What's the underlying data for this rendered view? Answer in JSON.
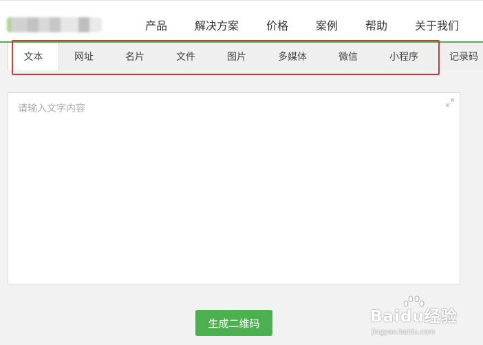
{
  "nav": {
    "items": [
      {
        "label": "产品"
      },
      {
        "label": "解决方案"
      },
      {
        "label": "价格"
      },
      {
        "label": "案例"
      },
      {
        "label": "帮助"
      },
      {
        "label": "关于我们"
      }
    ]
  },
  "tabs": {
    "items": [
      {
        "label": "文本",
        "active": true
      },
      {
        "label": "网址"
      },
      {
        "label": "名片"
      },
      {
        "label": "文件"
      },
      {
        "label": "图片"
      },
      {
        "label": "多媒体"
      },
      {
        "label": "微信"
      },
      {
        "label": "小程序"
      },
      {
        "label": "记录码"
      }
    ]
  },
  "editor": {
    "placeholder": "请输入文字内容",
    "value": "",
    "expand_icon": "expand-icon"
  },
  "actions": {
    "generate_label": "生成二维码"
  },
  "watermark": {
    "text": "Baidu经验",
    "url": "jingyan.baidu.com"
  },
  "colors": {
    "accent": "#4caf50",
    "highlight_box": "#cc3a3a"
  }
}
